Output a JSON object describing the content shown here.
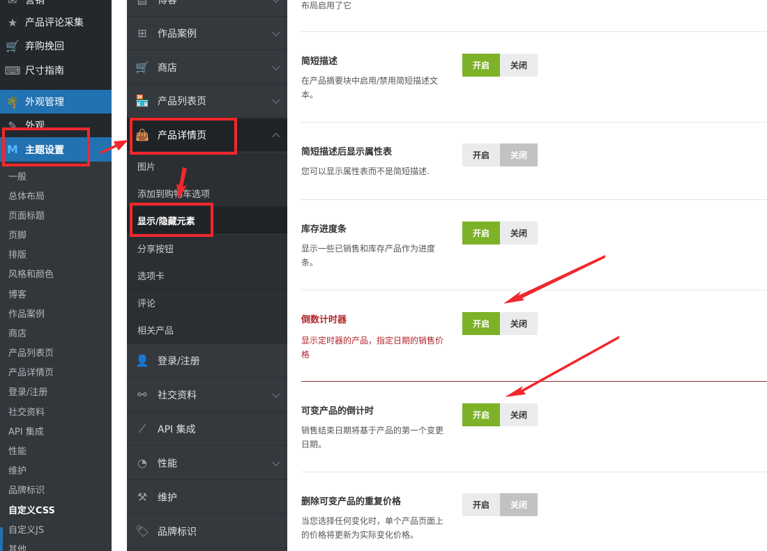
{
  "wp_menu": {
    "top_items": [
      {
        "label": "营销",
        "icon": "megaphone-icon"
      },
      {
        "label": "产品评论采集",
        "icon": "star-icon"
      },
      {
        "label": "弃购挽回",
        "icon": "cart-icon"
      },
      {
        "label": "尺寸指南",
        "icon": "keyboard-icon"
      }
    ],
    "appearance_manage": "外观管理",
    "appearance": "外观",
    "theme_settings": "主题设置",
    "sub_items": [
      "一般",
      "总体布局",
      "页面标题",
      "页脚",
      "排版",
      "风格和颜色",
      "博客",
      "作品案例",
      "商店",
      "产品列表页",
      "产品详情页",
      "登录/注册",
      "社交资料",
      "API 集成",
      "性能",
      "维护",
      "品牌标识",
      "自定义CSS",
      "自定义JS",
      "其他"
    ]
  },
  "options_nav": {
    "items_before": [
      {
        "label": "博客",
        "icon": "blog-icon"
      },
      {
        "label": "作品案例",
        "icon": "grid-icon"
      },
      {
        "label": "商店",
        "icon": "cart-icon"
      },
      {
        "label": "产品列表页",
        "icon": "store-icon"
      }
    ],
    "active": {
      "label": "产品详情页",
      "icon": "shopping-bag-icon"
    },
    "subs": [
      "图片",
      "添加到购物车选项",
      "显示/隐藏元素",
      "分享按钮",
      "选项卡",
      "评论",
      "相关产品"
    ],
    "items_after": [
      {
        "label": "登录/注册",
        "icon": "user-icon"
      },
      {
        "label": "社交资料",
        "icon": "sitemap-icon"
      },
      {
        "label": "API 集成",
        "icon": "api-icon"
      },
      {
        "label": "性能",
        "icon": "gauge-icon"
      },
      {
        "label": "维护",
        "icon": "hammer-icon"
      },
      {
        "label": "品牌标识",
        "icon": "tag-icon"
      }
    ]
  },
  "settings": {
    "top_fragment": "布局启用了它",
    "rows": [
      {
        "title": "简短描述",
        "desc": "在产品摘要块中启用/禁用简短描述文本。",
        "state": "on"
      },
      {
        "title": "简短描述后显示属性表",
        "desc": "您可以显示属性表而不是简短描述.",
        "state": "off"
      },
      {
        "title": "库存进度条",
        "desc": "显示一些已销售和库存产品作为进度条。",
        "state": "on"
      },
      {
        "title": "倒数计时器",
        "desc": "显示定时器的产品，指定日期的销售价格",
        "state": "on"
      },
      {
        "title": "可变产品的倒计时",
        "desc": "销售结束日期将基于产品的第一个变更日期。",
        "state": "on"
      },
      {
        "title": "删除可变产品的重复价格",
        "desc": "当您选择任何变化时，单个产品页面上的价格将更新为实际变化价格。",
        "state": "off"
      }
    ],
    "on_label": "开启",
    "off_label": "关闭"
  },
  "colors": {
    "on": "#7db228",
    "highlight_red": "#b0262b",
    "annotation": "#f0282d",
    "wp_blue": "#2271b1"
  }
}
